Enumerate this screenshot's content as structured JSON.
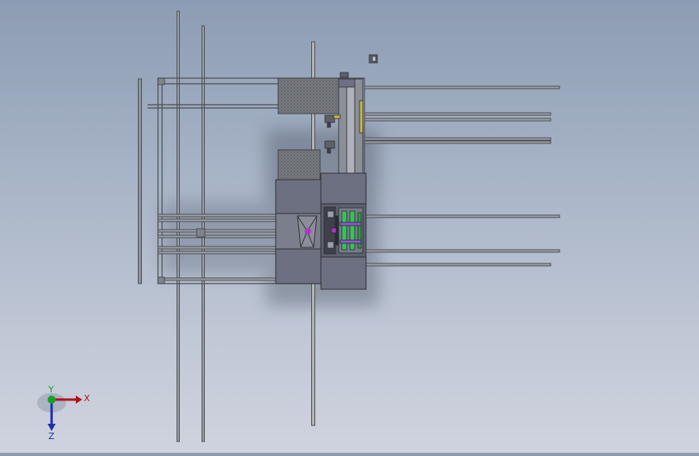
{
  "viewport": {
    "background_top": "#8c9cb3",
    "background_bottom": "#cfd3de"
  },
  "triad": {
    "x_label": "X",
    "y_label": "Y",
    "z_label": "Z",
    "x_color": "#b0121b",
    "y_color": "#1aa02a",
    "z_color": "#1c2fa8"
  },
  "model": {
    "frame_color": "#5e6168",
    "panel_color": "#6c7080",
    "mesh_color": "#6e6e6e",
    "accent_purple": "#b037c4",
    "accent_green": "#37c45b"
  }
}
